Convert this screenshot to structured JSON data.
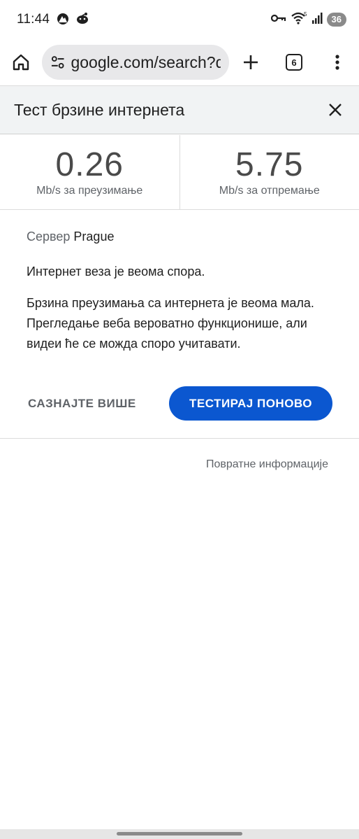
{
  "status_bar": {
    "time": "11:44",
    "battery": "36",
    "left_icons": [
      "nordvpn-icon",
      "reddit-icon"
    ],
    "right_icons": [
      "vpn-key-icon",
      "wifi-icon",
      "signal-icon"
    ]
  },
  "toolbar": {
    "url": "google.com/search?q",
    "tab_count": "6"
  },
  "speed_test": {
    "title": "Тест брзине интернета",
    "download": {
      "value": "0.26",
      "unit": "Mb/s за преузимање"
    },
    "upload": {
      "value": "5.75",
      "unit": "Mb/s за отпремање"
    },
    "server_label": "Сервер",
    "server_name": "Prague",
    "summary": "Интернет веза је веома спора.",
    "detail": "Брзина преузимања са интернета је веома мала. Прегледање веба вероватно функционише, али видеи ће се можда споро учитавати.",
    "learn_more_label": "САЗНАЈТЕ ВИШЕ",
    "test_again_label": "ТЕСТИРАЈ ПОНОВО",
    "feedback_label": "Повратне информације"
  },
  "colors": {
    "accent": "#0b57d0",
    "header_bg": "#f1f3f4",
    "url_bar_bg": "#e8e8ea"
  }
}
